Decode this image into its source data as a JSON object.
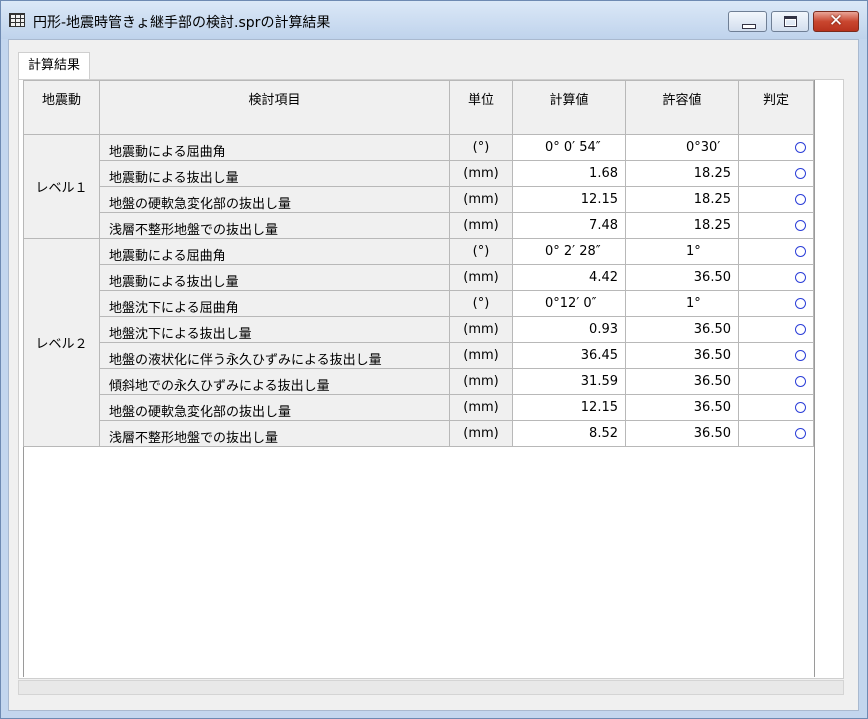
{
  "window": {
    "title": "円形-地震時管きょ継手部の検討.sprの計算結果",
    "minimize_icon": "minimize-icon",
    "maximize_icon": "maximize-icon",
    "close_icon": "close-icon",
    "close_glyph": "✕"
  },
  "tabs": [
    {
      "label": "計算結果",
      "active": true
    }
  ],
  "table": {
    "headers": {
      "group": "地震動",
      "item": "検討項目",
      "unit": "単位",
      "calc": "計算値",
      "allow": "許容値",
      "judge": "判定"
    },
    "groups": [
      {
        "label": "レベル１",
        "rows": [
          {
            "item": "地震動による屈曲角",
            "unit": "(°)",
            "calc": "0° 0′ 54″",
            "allow": "0°30′",
            "judge": "○"
          },
          {
            "item": "地震動による抜出し量",
            "unit": "(mm)",
            "calc": "1.68",
            "allow": "18.25",
            "judge": "○"
          },
          {
            "item": "地盤の硬軟急変化部の抜出し量",
            "unit": "(mm)",
            "calc": "12.15",
            "allow": "18.25",
            "judge": "○"
          },
          {
            "item": "浅層不整形地盤での抜出し量",
            "unit": "(mm)",
            "calc": "7.48",
            "allow": "18.25",
            "judge": "○"
          }
        ]
      },
      {
        "label": "レベル２",
        "rows": [
          {
            "item": "地震動による屈曲角",
            "unit": "(°)",
            "calc": "0° 2′ 28″",
            "allow": "1°",
            "judge": "○"
          },
          {
            "item": "地震動による抜出し量",
            "unit": "(mm)",
            "calc": "4.42",
            "allow": "36.50",
            "judge": "○"
          },
          {
            "item": "地盤沈下による屈曲角",
            "unit": "(°)",
            "calc": "0°12′  0″",
            "allow": "1°",
            "judge": "○"
          },
          {
            "item": "地盤沈下による抜出し量",
            "unit": "(mm)",
            "calc": "0.93",
            "allow": "36.50",
            "judge": "○"
          },
          {
            "item": "地盤の液状化に伴う永久ひずみによる抜出し量",
            "unit": "(mm)",
            "calc": "36.45",
            "allow": "36.50",
            "judge": "○"
          },
          {
            "item": "傾斜地での永久ひずみによる抜出し量",
            "unit": "(mm)",
            "calc": "31.59",
            "allow": "36.50",
            "judge": "○"
          },
          {
            "item": "地盤の硬軟急変化部の抜出し量",
            "unit": "(mm)",
            "calc": "12.15",
            "allow": "36.50",
            "judge": "○"
          },
          {
            "item": "浅層不整形地盤での抜出し量",
            "unit": "(mm)",
            "calc": "8.52",
            "allow": "36.50",
            "judge": "○"
          }
        ]
      }
    ]
  },
  "colors": {
    "judge_ok": "#2c3fd8",
    "title_bar": "#c3d6ee",
    "close_button": "#c9462f"
  }
}
